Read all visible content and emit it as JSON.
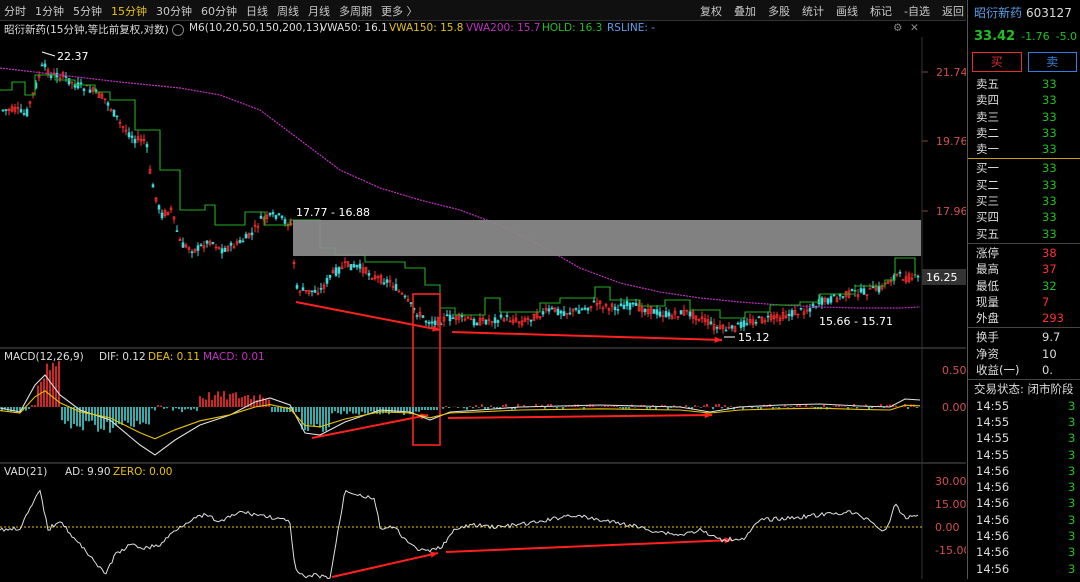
{
  "toolbar": {
    "periods": [
      "分时",
      "1分钟",
      "5分钟",
      "15分钟",
      "30分钟",
      "60分钟",
      "日线",
      "周线",
      "月线",
      "多周期",
      "更多 〉"
    ],
    "active_period": "15分钟",
    "actions": [
      "复权",
      "叠加",
      "多股",
      "统计",
      "画线",
      "标记",
      "-自选",
      "返回"
    ]
  },
  "info": {
    "title": "昭衍新药(15分钟,等比前复权,对数)",
    "ma": "M6(10,20,50,150,200,13)",
    "vwa50": "VWA50: 16.1",
    "vwa150": "VWA150: 15.8",
    "vwa200": "VWA200: 15.7",
    "hold": "HOLD: 16.3",
    "rsline": "RSLINE: -"
  },
  "price_axis": [
    "21.74",
    "19.76",
    "17.96"
  ],
  "price_tag": "16.25",
  "annotations": {
    "high": "22.37",
    "zone": "17.77 - 16.88",
    "low": "15.12",
    "range": "15.66 - 15.71"
  },
  "macd": {
    "title": "MACD(12,26,9)",
    "dif": "DIF: 0.12",
    "dea": "DEA: 0.11",
    "macd": "MACD: 0.01",
    "axis": [
      "0.50",
      "0.00"
    ]
  },
  "vad": {
    "title": "VAD(21)",
    "ad": "AD: 9.90",
    "zero": "ZERO: 0.00",
    "axis": [
      "30.00",
      "15.00",
      "0.00",
      "-15.00"
    ]
  },
  "colors": {
    "up": "#ff3030",
    "down": "#40d8d8",
    "purple": "#c030c0",
    "green_line": "#20b020",
    "yellow": "#e8c300",
    "white": "#e0e0e0"
  },
  "panel": {
    "name": "昭衍新药",
    "code": "603127",
    "price": "33.42",
    "change": "-1.76",
    "pct": "-5.0",
    "buy_label": "买",
    "sell_label": "卖",
    "asks": [
      {
        "label": "卖五",
        "value": "33"
      },
      {
        "label": "卖四",
        "value": "33"
      },
      {
        "label": "卖三",
        "value": "33"
      },
      {
        "label": "卖二",
        "value": "33"
      },
      {
        "label": "卖一",
        "value": "33"
      }
    ],
    "bids": [
      {
        "label": "买一",
        "value": "33"
      },
      {
        "label": "买二",
        "value": "33"
      },
      {
        "label": "买三",
        "value": "33"
      },
      {
        "label": "买四",
        "value": "33"
      },
      {
        "label": "买五",
        "value": "33"
      }
    ],
    "stats": [
      {
        "label": "涨停",
        "value": "38",
        "color": "#ff3030"
      },
      {
        "label": "最高",
        "value": "37",
        "color": "#ff3030"
      },
      {
        "label": "最低",
        "value": "32",
        "color": "#20c020"
      },
      {
        "label": "现量",
        "value": "7",
        "color": "#ff3030"
      },
      {
        "label": "外盘",
        "value": "293",
        "color": "#ff3030"
      }
    ],
    "stats2": [
      {
        "label": "换手",
        "value": "9.7",
        "color": "#ddd"
      },
      {
        "label": "净资",
        "value": "10",
        "color": "#ddd"
      },
      {
        "label": "收益(一)",
        "value": "0.",
        "color": "#ddd"
      }
    ],
    "trade_status": "交易状态: 闭市阶段",
    "ticks": [
      {
        "time": "14:55",
        "value": "3"
      },
      {
        "time": "14:55",
        "value": "3"
      },
      {
        "time": "14:55",
        "value": "3"
      },
      {
        "time": "14:55",
        "value": "3"
      },
      {
        "time": "14:56",
        "value": "3"
      },
      {
        "time": "14:56",
        "value": "3"
      },
      {
        "time": "14:56",
        "value": "3"
      },
      {
        "time": "14:56",
        "value": "3"
      },
      {
        "time": "14:56",
        "value": "3"
      },
      {
        "time": "14:56",
        "value": "3"
      },
      {
        "time": "14:56",
        "value": "3"
      }
    ]
  }
}
